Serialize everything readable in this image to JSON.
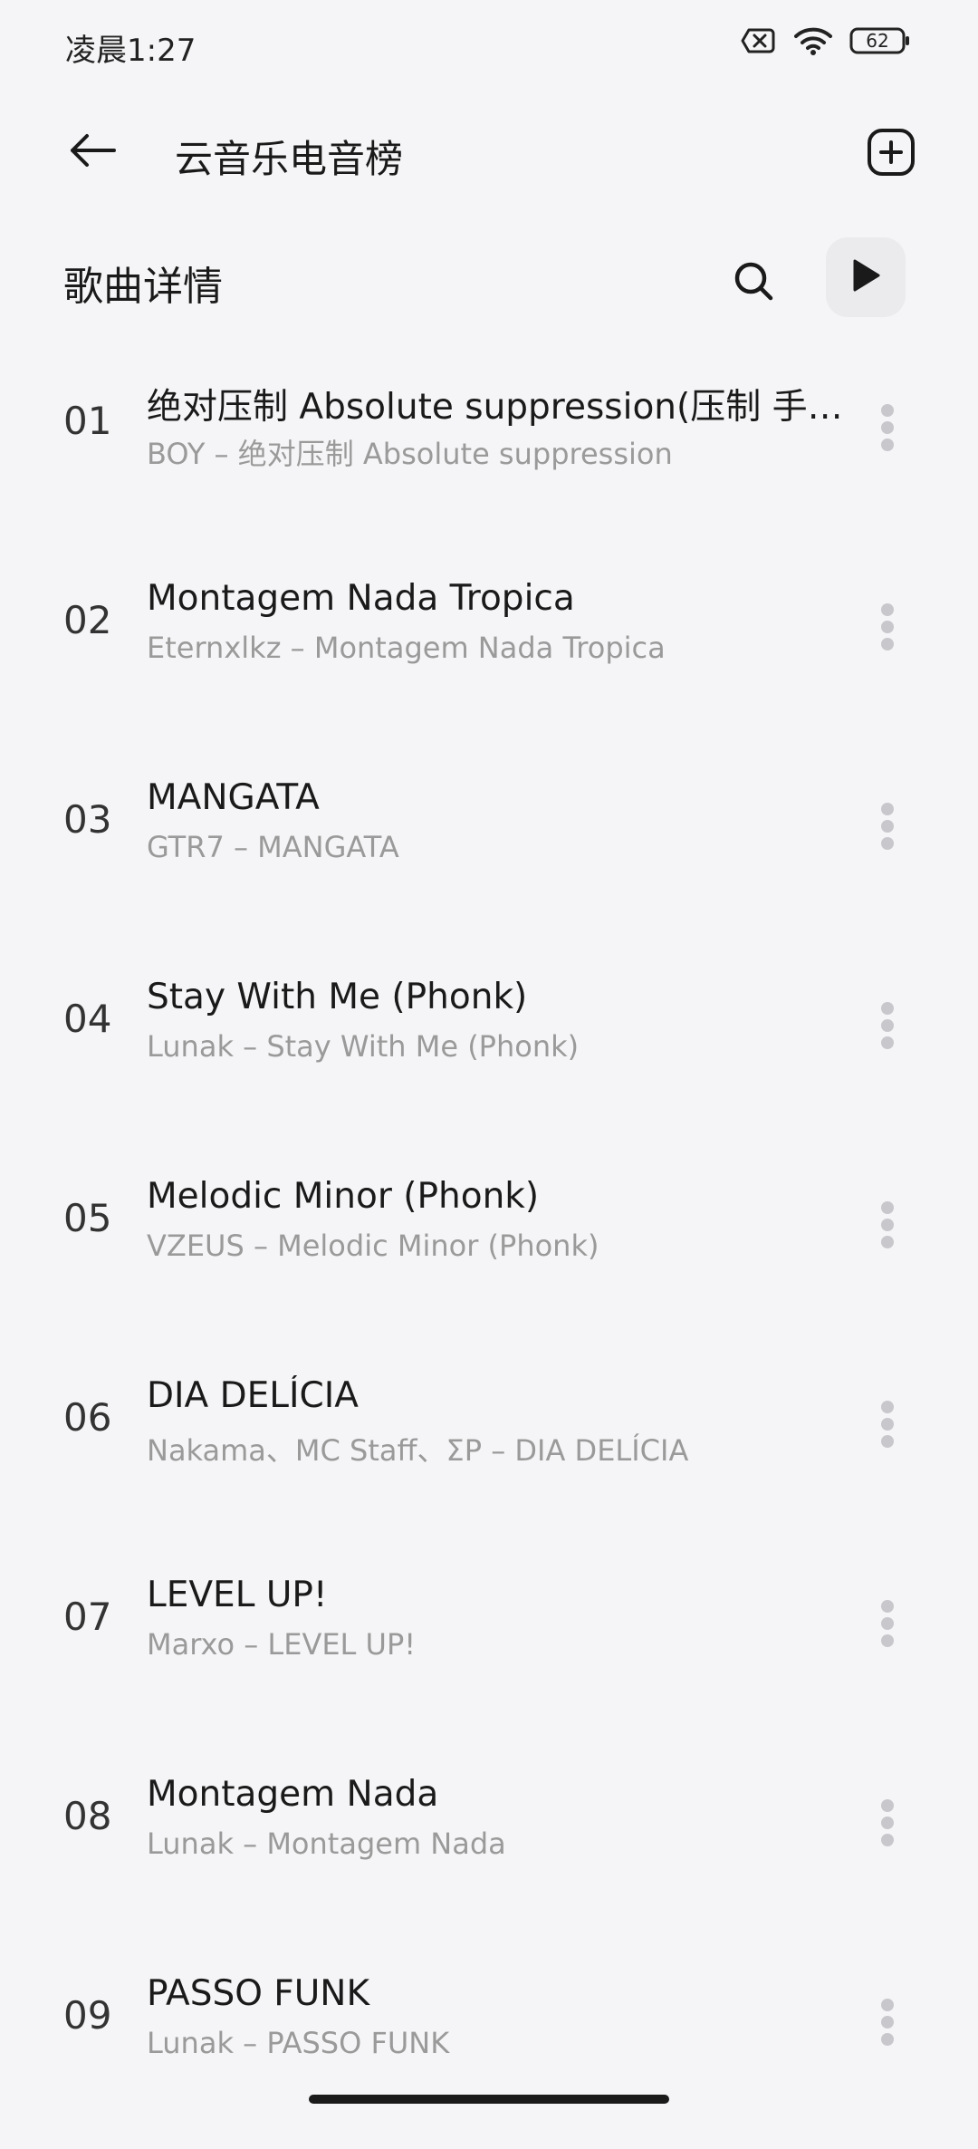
{
  "status_bar": {
    "time": "凌晨1:27",
    "battery": "62",
    "icons": [
      "no-sim-icon",
      "wifi-icon",
      "battery-icon"
    ]
  },
  "header": {
    "title": "云音乐电音榜"
  },
  "section": {
    "title": "歌曲详情"
  },
  "songs": [
    {
      "index": "01",
      "title": "绝对压制 Absolute suppression(压制 手法…",
      "subtitle": "BOY – 绝对压制 Absolute suppression"
    },
    {
      "index": "02",
      "title": "Montagem Nada Tropica",
      "subtitle": "Eternxlkz – Montagem Nada Tropica"
    },
    {
      "index": "03",
      "title": "MANGATA",
      "subtitle": "GTR7 – MANGATA"
    },
    {
      "index": "04",
      "title": "Stay With Me (Phonk)",
      "subtitle": "Lunak – Stay With Me (Phonk)"
    },
    {
      "index": "05",
      "title": "Melodic Minor (Phonk)",
      "subtitle": "VZEUS – Melodic Minor (Phonk)"
    },
    {
      "index": "06",
      "title": "DIA DELÍCIA",
      "subtitle": "Nakama、MC Staff、ΣP – DIA DELÍCIA"
    },
    {
      "index": "07",
      "title": "LEVEL UP!",
      "subtitle": "Marxo – LEVEL UP!"
    },
    {
      "index": "08",
      "title": "Montagem Nada",
      "subtitle": "Lunak – Montagem Nada"
    },
    {
      "index": "09",
      "title": "PASSO FUNK",
      "subtitle": "Lunak – PASSO FUNK"
    }
  ],
  "colors": {
    "background": "#f5f5f7",
    "primary_text": "#1a1a1a",
    "secondary_text": "#9a9a9a",
    "play_button_bg": "#ebebee"
  }
}
